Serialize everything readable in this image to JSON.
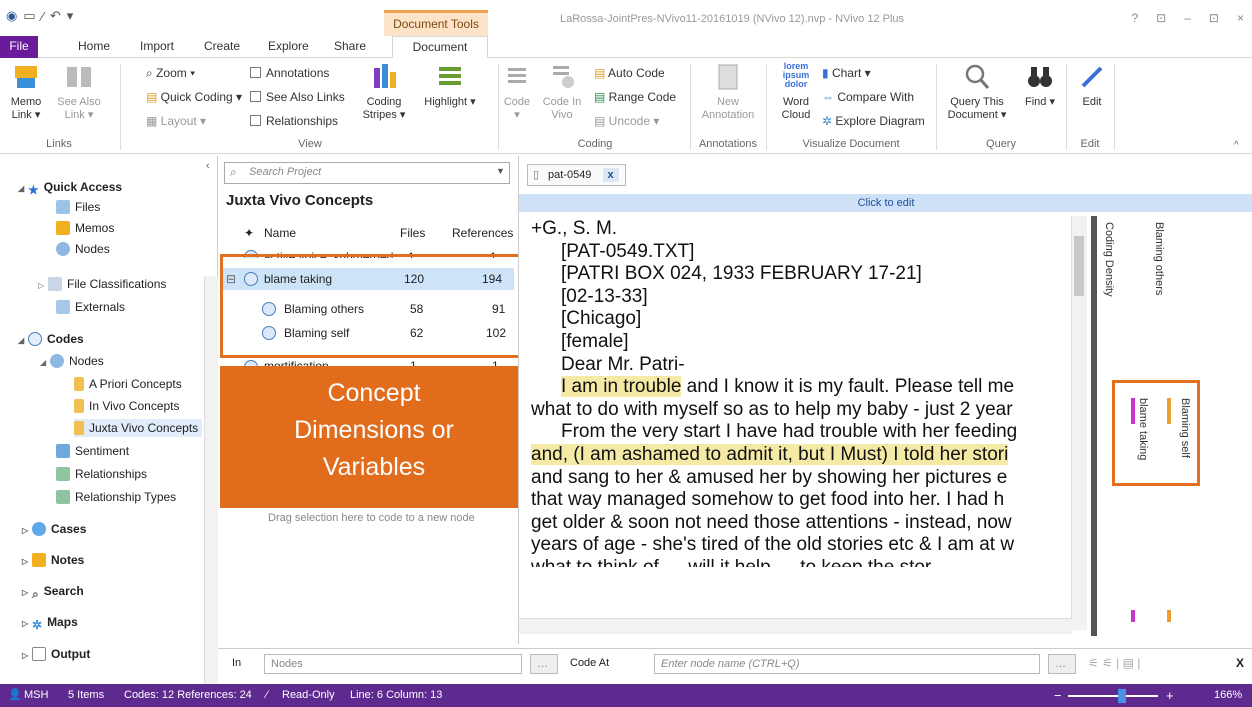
{
  "window": {
    "title": "LaRossa-JointPres-NVivo11-20161019 (NVivo 12).nvp - NVivo 12 Plus",
    "context_group": "Document Tools",
    "controls": [
      "?",
      "⊡",
      "–",
      "⊡",
      "×"
    ]
  },
  "tabs": [
    "File",
    "Home",
    "Import",
    "Create",
    "Explore",
    "Share",
    "Document"
  ],
  "ribbon": {
    "links": {
      "memo_link": "Memo Link ▾",
      "see_also": "See Also Link ▾",
      "label": "Links"
    },
    "view": {
      "zoom": "Zoom ▾",
      "quick_coding": "Quick Coding ▾",
      "layout": "Layout ▾",
      "annotations": "Annotations",
      "see_also_links": "See Also Links",
      "relationships": "Relationships",
      "coding_stripes": "Coding Stripes ▾",
      "highlight": "Highlight ▾",
      "label": "View"
    },
    "coding": {
      "code": "Code ▾",
      "code_in_vivo": "Code In Vivo",
      "auto_code": "Auto Code",
      "range_code": "Range Code",
      "uncode": "Uncode ▾",
      "label": "Coding"
    },
    "annotations": {
      "new_annotation": "New Annotation",
      "label": "Annotations"
    },
    "visualize": {
      "word_cloud": "Word Cloud",
      "word_cloud_icon": "lorem ipsum dolor",
      "chart": "Chart ▾",
      "compare_with": "Compare With",
      "explore_diagram": "Explore Diagram",
      "label": "Visualize Document"
    },
    "query": {
      "query_this": "Query This Document ▾",
      "find": "Find ▾",
      "label": "Query"
    },
    "edit": {
      "edit": "Edit",
      "label": "Edit"
    }
  },
  "nav": {
    "quick_access": "Quick Access",
    "files": "Files",
    "memos": "Memos",
    "nodes_qa": "Nodes",
    "file_classifications": "File Classifications",
    "externals": "Externals",
    "codes": "Codes",
    "nodes": "Nodes",
    "a_priori": "A Priori Concepts",
    "in_vivo": "In Vivo Concepts",
    "juxta_vivo": "Juxta Vivo Concepts",
    "sentiment": "Sentiment",
    "relationships": "Relationships",
    "relationship_types": "Relationship Types",
    "cases": "Cases",
    "notes": "Notes",
    "search": "Search",
    "maps": "Maps",
    "output": "Output"
  },
  "list": {
    "search_placeholder": "Search Project",
    "title": "Juxta Vivo Concepts",
    "col_name": "Name",
    "col_files": "Files",
    "col_refs": "References",
    "rows": [
      {
        "name": "active voice, submerged",
        "files": "1",
        "refs": "1"
      },
      {
        "name": "blame taking",
        "files": "120",
        "refs": "194"
      },
      {
        "name": "Blaming others",
        "files": "58",
        "refs": "91"
      },
      {
        "name": "Blaming self",
        "files": "62",
        "refs": "102"
      },
      {
        "name": "mortification",
        "files": "1",
        "refs": "1"
      }
    ],
    "drag_hint": "Drag selection here to code to a new node"
  },
  "overlay": {
    "line1": "Concept",
    "line2": "Dimensions or",
    "line3": "Variables"
  },
  "doc": {
    "tab": "pat-0549",
    "click_to_edit": "Click to edit",
    "lines": [
      "+G., S. M.",
      "[PAT-0549.TXT]",
      "[PATRI BOX 024, 1933 FEBRUARY 17-21]",
      "[02-13-33]",
      "[Chicago]",
      "[female]",
      "Dear Mr. Patri-"
    ],
    "hl1": "I am in trouble",
    "p1_rest": " and I know it is my fault.  Please tell me",
    "p1_cont": "what to do with myself so as to help my baby - just 2 year",
    "p2_l1": "From the very start I have had trouble with her feeding",
    "hl2": "and, (I am ashamed to admit it, but I Must) I told her stori",
    "p2_l3": "and sang to her & amused her by showing her pictures e",
    "p2_l4": "that way managed somehow to get food into her.  I had h",
    "p2_l5": "get older & soon not need those attentions - instead, now",
    "p2_l6": "years of age - she's tired of the old stories etc & I am at w",
    "p2_l7": "what to think of — will it help … to keep the stor…"
  },
  "stripes": {
    "coding_density": "Coding Density",
    "blaming_others": "Blaming others",
    "blaming_self": "Blaming self",
    "blame_taking": "blame taking",
    "colors": {
      "blame_taking": "#cc33cc",
      "blaming_self": "#e8a030"
    }
  },
  "codebar": {
    "in": "In",
    "nodes": "Nodes",
    "code_at": "Code At",
    "node_placeholder": "Enter node name (CTRL+Q)",
    "close": "X"
  },
  "status": {
    "user": "MSH",
    "items": "5 Items",
    "codes": "Codes: 12  References: 24",
    "readonly": "Read-Only",
    "position": "Line: 6  Column: 13",
    "zoom": "166%"
  }
}
